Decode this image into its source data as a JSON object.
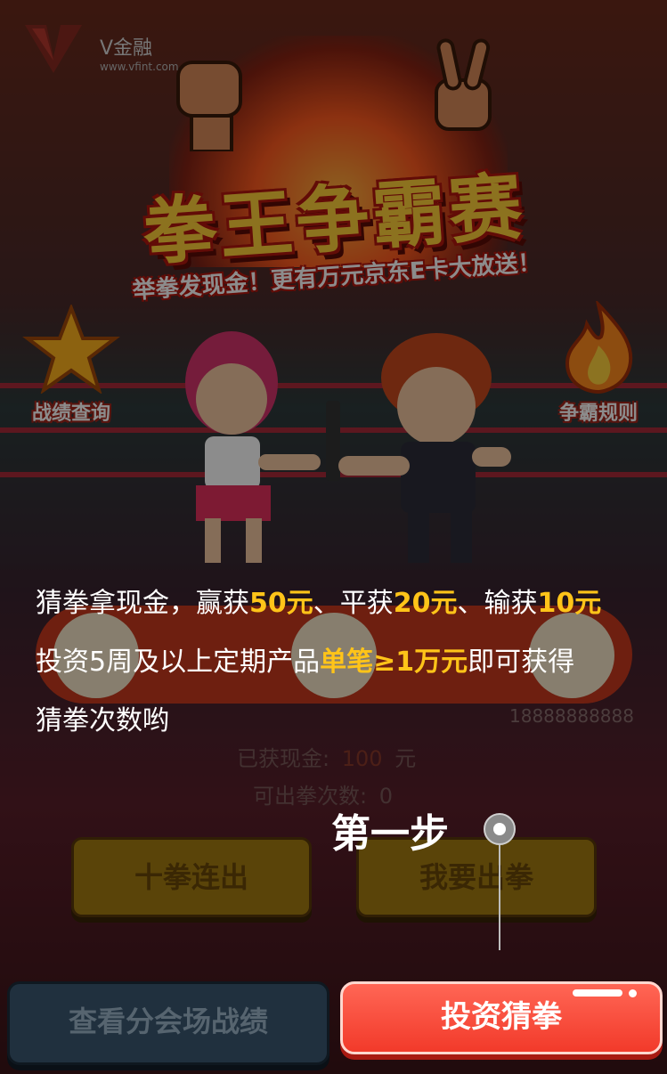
{
  "app": {
    "brand": "V金融",
    "url": "www.vfint.com"
  },
  "banner": {
    "title": "拳王争霸赛",
    "subtitle": "举拳发现金！更有万元京东E卡大放送！"
  },
  "side_buttons": {
    "record": "战绩查询",
    "rules": "争霸规则"
  },
  "game": {
    "phone": "18888888888",
    "cash_label": "已获现金:",
    "cash_value": "100",
    "cash_unit": "元",
    "count_label": "可出拳次数:",
    "count_value": "0",
    "ten_button": "十拳连出",
    "play_button": "我要出拳"
  },
  "info": {
    "line1_a": "猜拳拿现金，赢获",
    "line1_b": "50元",
    "line1_c": "、平获",
    "line1_d": "20元",
    "line1_e": "、输获",
    "line1_f": "10元",
    "line2_a": "投资5周及以上定期产品",
    "line2_b": "单笔≥1万元",
    "line2_c": "即可获得",
    "line3": "猜拳次数哟"
  },
  "guide": {
    "step": "第一步"
  },
  "bottom": {
    "left_button": "查看分会场战绩",
    "right_button": "投资猜拳"
  },
  "colors": {
    "highlight": "#ffc419",
    "primary_red": "#f23a2a",
    "title_gold": "#ffcf3a"
  }
}
